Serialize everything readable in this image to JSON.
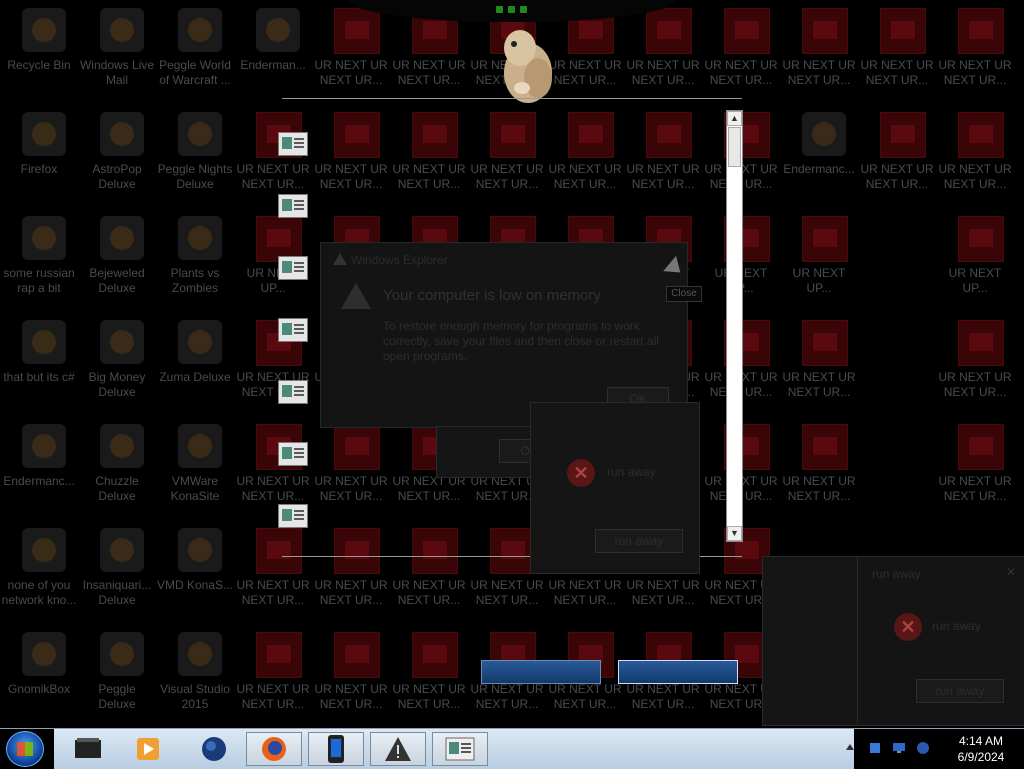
{
  "desktop": {
    "columns": [
      [
        "Recycle Bin",
        "Firefox",
        "some russian rap a bit",
        "that but its c#",
        "Endermanc...",
        "none of you network kno...",
        "GnomikBox"
      ],
      [
        "Windows Live Mail",
        "AstroPop Deluxe",
        "Bejeweled Deluxe",
        "Big Money Deluxe",
        "Chuzzle Deluxe",
        "Insaniquari... Deluxe",
        "Peggle Deluxe"
      ],
      [
        "Peggle World of Warcraft ...",
        "Peggle Nights Deluxe",
        "Plants vs Zombies",
        "Zuma Deluxe",
        "VMWare KonaSite",
        "VMD KonaS...",
        "Visual Studio 2015"
      ]
    ],
    "fourth_icon": "Enderman...",
    "ur_label": "UR NEXT UR NEXT UR...",
    "ur_label_short": "UR NEXT UP...",
    "ender_label": "Endermanc..."
  },
  "mem_dialog": {
    "title": "Windows Explorer",
    "heading": "Your computer is low on memory",
    "body": "To restore enough memory for programs to work correctly, save your files and then close or restart all open programs.",
    "ok": "OK"
  },
  "tooltip": "Close",
  "err_dialog_small": {
    "button": "OK"
  },
  "err_dialog_2": {
    "message": "run away",
    "button": "run away"
  },
  "err_dialog_3": {
    "title": "run away",
    "message": "run away",
    "button": "run away"
  },
  "taskbar": {
    "time": "4:14 AM",
    "date": "6/9/2024"
  },
  "colors": {
    "taskbar": "#c8d8ea",
    "accent_blue": "#1e4a86"
  }
}
